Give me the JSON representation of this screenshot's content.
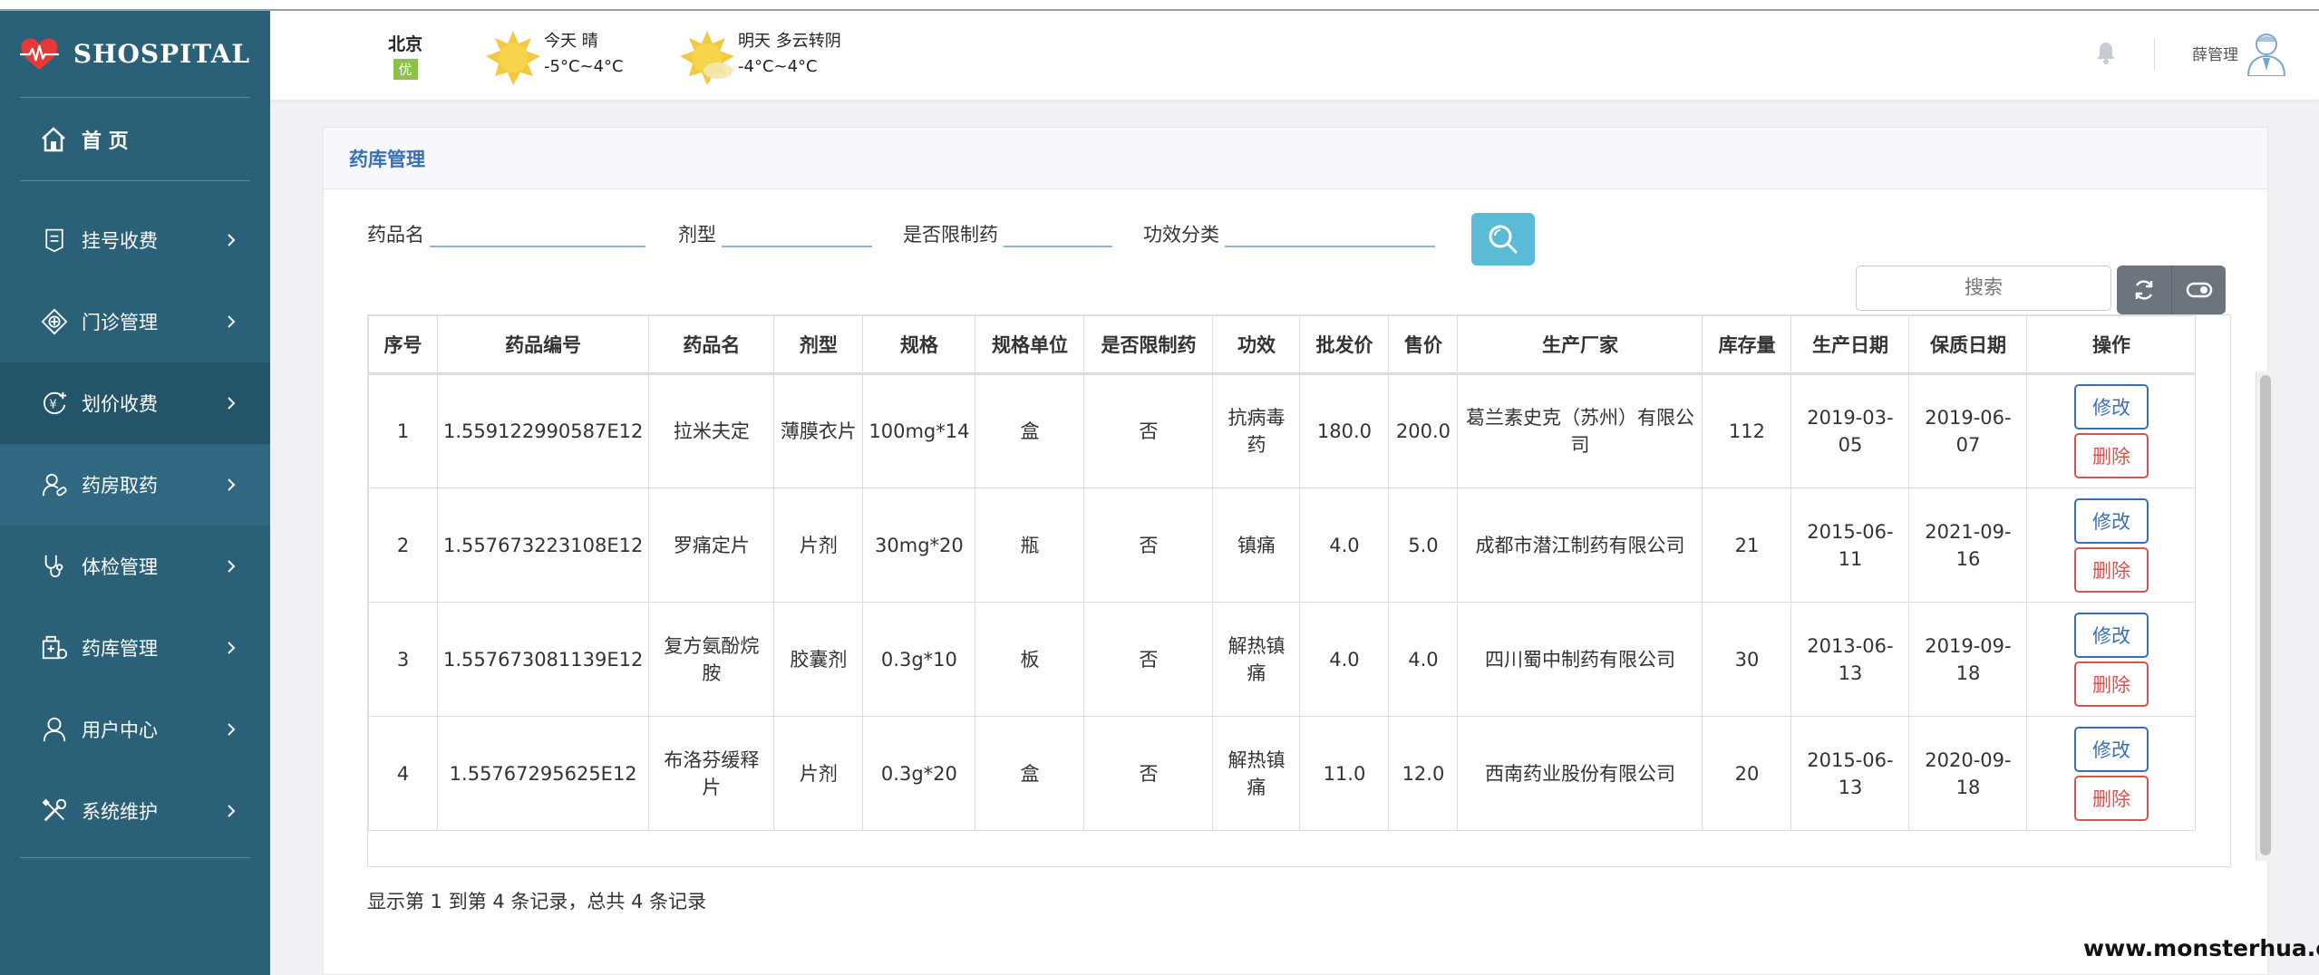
{
  "brand": {
    "name": "SHOSPITAL"
  },
  "sidebar": {
    "home_label": "首 页",
    "items": [
      {
        "label": "挂号收费",
        "icon": "register-icon"
      },
      {
        "label": "门诊管理",
        "icon": "clinic-icon"
      },
      {
        "label": "划价收费",
        "icon": "pricing-icon"
      },
      {
        "label": "药房取药",
        "icon": "pharmacy-icon"
      },
      {
        "label": "体检管理",
        "icon": "stethoscope-icon"
      },
      {
        "label": "药库管理",
        "icon": "drug-store-icon"
      },
      {
        "label": "用户中心",
        "icon": "user-icon"
      },
      {
        "label": "系统维护",
        "icon": "tools-icon"
      }
    ]
  },
  "header": {
    "city": "北京",
    "aqi": "优",
    "today": {
      "label": "今天  晴",
      "temp": "-5°C~4°C"
    },
    "tomorrow": {
      "label": "明天  多云转阴",
      "temp": "-4°C~4°C"
    },
    "user_name": "薛管理"
  },
  "panel": {
    "title": "药库管理"
  },
  "filters": {
    "drug_name_label": "药品名",
    "dosage_form_label": "剂型",
    "restricted_label": "是否限制药",
    "efficacy_label": "功效分类"
  },
  "table_search": {
    "placeholder": "搜索"
  },
  "table": {
    "columns": [
      "序号",
      "药品编号",
      "药品名",
      "剂型",
      "规格",
      "规格单位",
      "是否限制药",
      "功效",
      "批发价",
      "售价",
      "生产厂家",
      "库存量",
      "生产日期",
      "保质日期",
      "操作"
    ],
    "rows": [
      [
        "1",
        "1.559122990587E12",
        "拉米夫定",
        "薄膜衣片",
        "100mg*14",
        "盒",
        "否",
        "抗病毒药",
        "180.0",
        "200.0",
        "葛兰素史克（苏州）有限公司",
        "112",
        "2019-03-05",
        "2019-06-07"
      ],
      [
        "2",
        "1.557673223108E12",
        "罗痛定片",
        "片剂",
        "30mg*20",
        "瓶",
        "否",
        "镇痛",
        "4.0",
        "5.0",
        "成都市潜江制药有限公司",
        "21",
        "2015-06-11",
        "2021-09-16"
      ],
      [
        "3",
        "1.557673081139E12",
        "复方氨酚烷胺",
        "胶囊剂",
        "0.3g*10",
        "板",
        "否",
        "解热镇痛",
        "4.0",
        "4.0",
        "四川蜀中制药有限公司",
        "30",
        "2013-06-13",
        "2019-09-18"
      ],
      [
        "4",
        "1.55767295625E12",
        "布洛芬缓释片",
        "片剂",
        "0.3g*20",
        "盒",
        "否",
        "解热镇痛",
        "11.0",
        "12.0",
        "西南药业股份有限公司",
        "20",
        "2015-06-13",
        "2020-09-18"
      ]
    ],
    "edit_label": "修改",
    "delete_label": "删除"
  },
  "pagination_info": "显示第 1 到第 4 条记录，总共 4 条记录",
  "watermark": "www.monsterhua.com",
  "colors": {
    "sidebar_bg": "#2b6178",
    "accent": "#3a6fb8",
    "danger": "#d9534f",
    "search_btn": "#5bbad5"
  }
}
